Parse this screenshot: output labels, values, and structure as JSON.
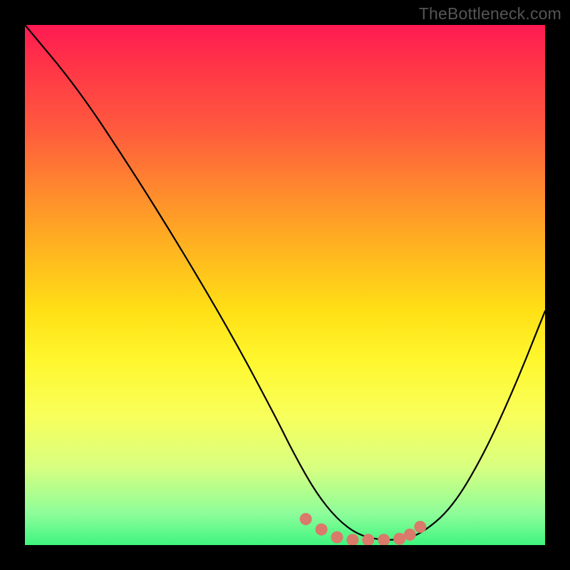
{
  "watermark": "TheBottleneck.com",
  "chart_data": {
    "type": "line",
    "title": "",
    "xlabel": "",
    "ylabel": "",
    "xlim": [
      0,
      100
    ],
    "ylim": [
      0,
      100
    ],
    "series": [
      {
        "name": "curve",
        "x": [
          0,
          10,
          20,
          30,
          40,
          48,
          52,
          56,
          60,
          64,
          68,
          72,
          76,
          82,
          88,
          94,
          100
        ],
        "values": [
          100,
          88,
          73,
          57,
          40,
          25,
          17,
          10,
          5,
          2,
          1,
          1,
          2,
          7,
          17,
          30,
          45
        ]
      }
    ],
    "markers": [
      {
        "x": 54,
        "y": 5
      },
      {
        "x": 57,
        "y": 3
      },
      {
        "x": 60,
        "y": 1.5
      },
      {
        "x": 63,
        "y": 1
      },
      {
        "x": 66,
        "y": 1
      },
      {
        "x": 69,
        "y": 1
      },
      {
        "x": 72,
        "y": 1.2
      },
      {
        "x": 74,
        "y": 2
      },
      {
        "x": 76,
        "y": 3.5
      }
    ],
    "marker_color": "#d97a6a",
    "curve_color": "#000000",
    "grid": false
  }
}
